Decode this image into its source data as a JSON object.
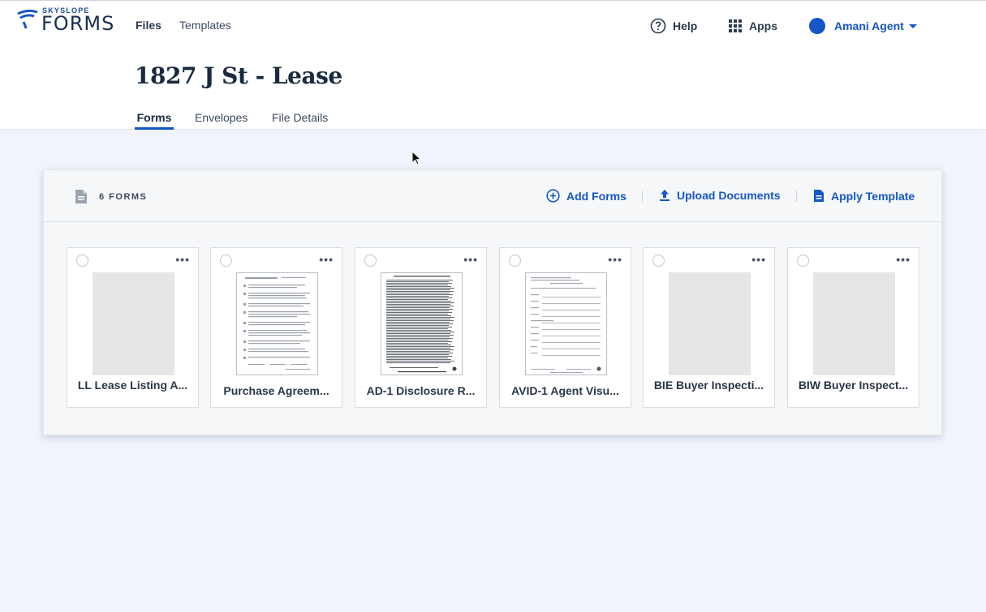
{
  "brand": {
    "small": "SKYSLOPE",
    "big": "FORMS"
  },
  "nav": {
    "files": "Files",
    "templates": "Templates"
  },
  "top_actions": {
    "help": "Help",
    "apps": "Apps",
    "user": "Amani Agent"
  },
  "page": {
    "title": "1827 J St - Lease"
  },
  "tabs": [
    "Forms",
    "Envelopes",
    "File Details"
  ],
  "panel": {
    "count_label": "6 FORMS",
    "add_forms": "Add Forms",
    "upload_documents": "Upload Documents",
    "apply_template": "Apply Template"
  },
  "cards": [
    {
      "name": "LL Lease Listing A...",
      "thumbnail": "blank"
    },
    {
      "name": "Purchase Agreem...",
      "thumbnail": "document"
    },
    {
      "name": "AD-1 Disclosure R...",
      "thumbnail": "document"
    },
    {
      "name": "AVID-1 Agent Visu...",
      "thumbnail": "document"
    },
    {
      "name": "BIE Buyer Inspecti...",
      "thumbnail": "blank"
    },
    {
      "name": "BIW Buyer Inspect...",
      "thumbnail": "blank"
    }
  ],
  "colors": {
    "accent": "#1456c6",
    "background": "#f0f4fb",
    "title": "#1a2a40"
  },
  "icons": [
    "help-icon",
    "apps-grid-icon",
    "dropdown-caret-icon",
    "document-icon",
    "add-circle-icon",
    "upload-icon",
    "template-icon",
    "more-icon",
    "checkbox-icon"
  ]
}
